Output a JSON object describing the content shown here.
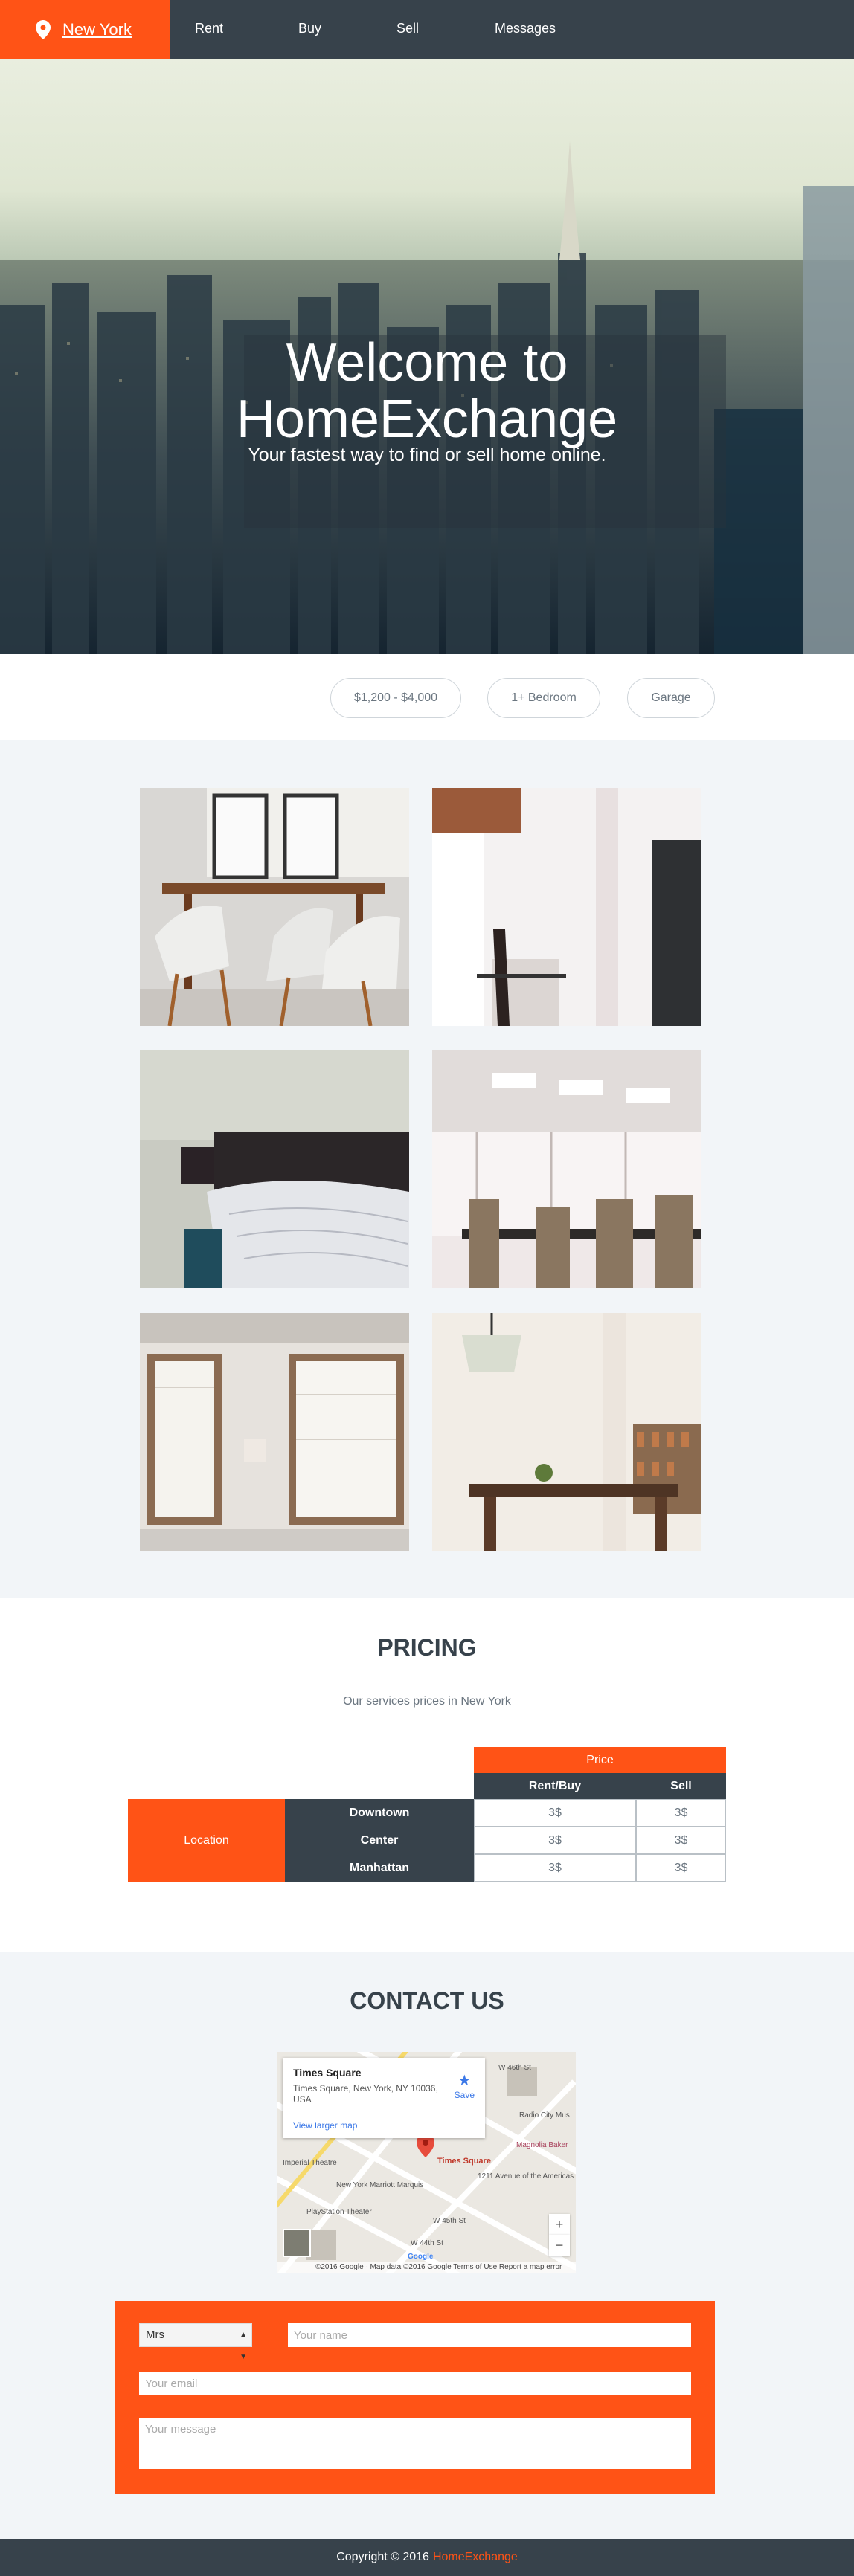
{
  "header": {
    "city": "New York",
    "nav": [
      "Rent",
      "Buy",
      "Sell",
      "Messages"
    ]
  },
  "hero": {
    "title_line1": "Welcome to",
    "title_line2": "HomeExchange",
    "subtitle": "Your fastest way to find or sell home online."
  },
  "filters": [
    "$1,200 - $4,000",
    "1+ Bedroom",
    "Garage"
  ],
  "pricing": {
    "title": "PRICING",
    "subtitle": "Our services prices in New York",
    "price_header": "Price",
    "col_rent_buy": "Rent/Buy",
    "col_sell": "Sell",
    "location_label": "Location",
    "rows": [
      {
        "area": "Downtown",
        "rent_buy": "3$",
        "sell": "3$"
      },
      {
        "area": "Center",
        "rent_buy": "3$",
        "sell": "3$"
      },
      {
        "area": "Manhattan",
        "rent_buy": "3$",
        "sell": "3$"
      }
    ]
  },
  "contact": {
    "title": "CONTACT US",
    "map": {
      "place": "Times Square",
      "address": "Times Square, New York, NY 10036, USA",
      "larger_map": "View larger map",
      "save": "Save",
      "pin_label": "Times Square",
      "footer": "©2016 Google · Map data ©2016 Google    Terms of Use    Report a map error",
      "labels": [
        "W 46th St",
        "Radio City Mus",
        "Magnolia Baker",
        "Imperial Theatre",
        "New York Marriott Marquis",
        "1211 Avenue of the Americas",
        "PlayStation Theater",
        "W 45th St",
        "W 44th St",
        "Google"
      ]
    },
    "form": {
      "title_value": "Mrs",
      "name_placeholder": "Your name",
      "email_placeholder": "Your email",
      "message_placeholder": "Your message"
    }
  },
  "footer": {
    "copyright": "Copyright © 2016",
    "brand": "HomeExchange"
  },
  "colors": {
    "accent": "#ff5316",
    "dark": "#37424b",
    "light_bg": "#f2f5f8"
  }
}
